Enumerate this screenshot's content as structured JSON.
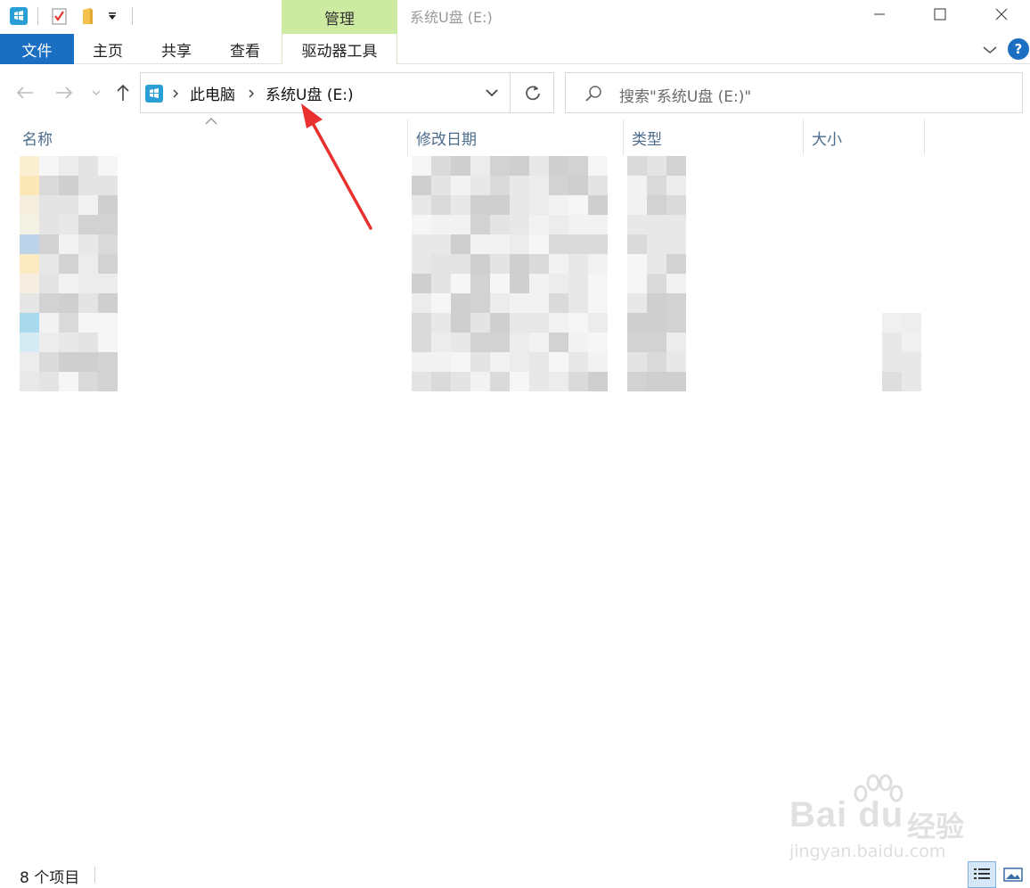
{
  "titlebar": {
    "contextual_tab": "管理",
    "window_title": "系统U盘 (E:)"
  },
  "ribbon": {
    "tabs": [
      "文件",
      "主页",
      "共享",
      "查看",
      "驱动器工具"
    ]
  },
  "address": {
    "crumbs": [
      "此电脑",
      "系统U盘 (E:)"
    ]
  },
  "search": {
    "placeholder": "搜索\"系统U盘 (E:)\""
  },
  "columns": [
    "名称",
    "修改日期",
    "类型",
    "大小"
  ],
  "statusbar": {
    "item_count": "8 个项目"
  },
  "watermark": {
    "brand": "Bai du",
    "product": "经验",
    "url": "jingyan.baidu.com"
  },
  "colors": {
    "accent": "#1a6fc2",
    "contextual_tab": "#cdeaa2",
    "annotation_arrow": "#e8312e",
    "column_header_text": "#4b6b8a"
  },
  "icons": [
    "usb-drive-icon",
    "properties-icon",
    "new-folder-icon",
    "customize-toolbar-icon",
    "minimize-icon",
    "maximize-icon",
    "close-icon",
    "chevron-down-icon",
    "help-icon",
    "back-arrow-icon",
    "forward-arrow-icon",
    "recent-locations-icon",
    "up-arrow-icon",
    "refresh-icon",
    "search-icon",
    "sort-ascending-icon",
    "details-view-icon",
    "large-icons-view-icon"
  ]
}
